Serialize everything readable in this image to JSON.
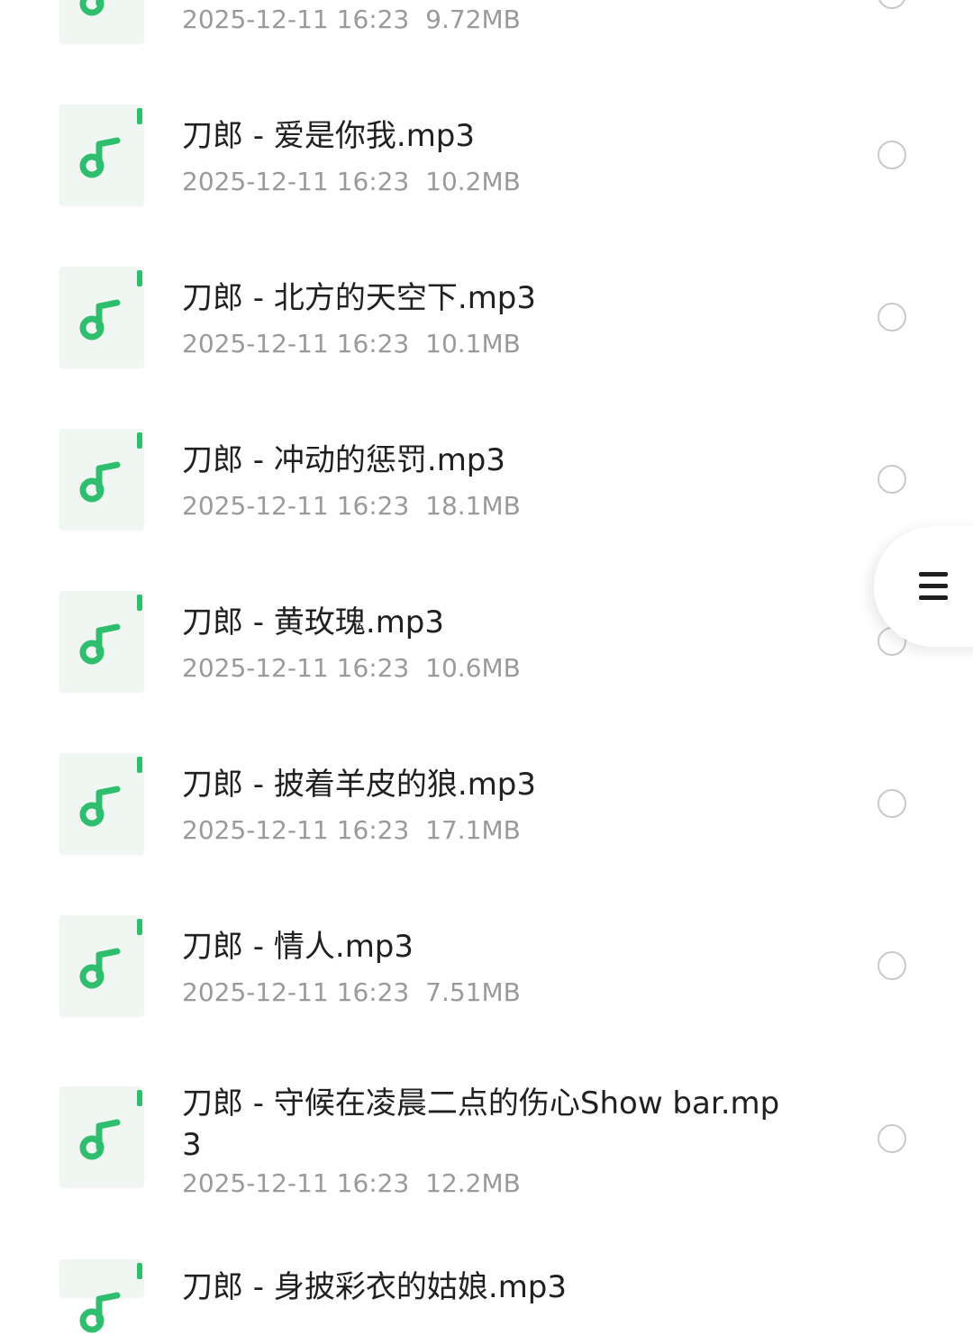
{
  "files": [
    {
      "name": "",
      "date": "2025-12-11 16:23",
      "size": "9.72MB"
    },
    {
      "name": "刀郎 - 爱是你我.mp3",
      "date": "2025-12-11 16:23",
      "size": "10.2MB"
    },
    {
      "name": "刀郎 - 北方的天空下.mp3",
      "date": "2025-12-11 16:23",
      "size": "10.1MB"
    },
    {
      "name": "刀郎 - 冲动的惩罚.mp3",
      "date": "2025-12-11 16:23",
      "size": "18.1MB"
    },
    {
      "name": "刀郎 - 黄玫瑰.mp3",
      "date": "2025-12-11 16:23",
      "size": "10.6MB"
    },
    {
      "name": "刀郎 - 披着羊皮的狼.mp3",
      "date": "2025-12-11 16:23",
      "size": "17.1MB"
    },
    {
      "name": "刀郎 - 情人.mp3",
      "date": "2025-12-11 16:23",
      "size": "7.51MB"
    },
    {
      "name": "刀郎 - 守候在凌晨二点的伤心Show bar.mp3",
      "date": "2025-12-11 16:23",
      "size": "12.2MB"
    },
    {
      "name": "刀郎 - 身披彩衣的姑娘.mp3",
      "date": "",
      "size": ""
    }
  ],
  "icons": {
    "file": "music-note-icon",
    "select": "radio-unchecked-icon",
    "menu": "menu-icon"
  },
  "colors": {
    "accent": "#2fbd6e",
    "icon_bg": "#f0f7f2",
    "title_text": "#202020",
    "meta_text": "#9a9a9a",
    "radio_border": "#c9c9c9"
  }
}
